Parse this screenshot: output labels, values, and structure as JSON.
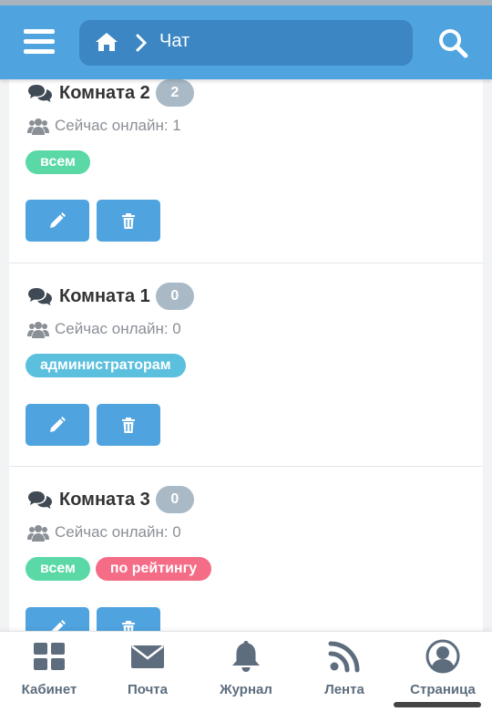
{
  "header": {
    "breadcrumb_label": "Чат",
    "home_icon": "home-icon",
    "chevron_icon": "chevron-right-icon",
    "menu_icon": "hamburger-menu-icon",
    "search_icon": "search-icon",
    "bg_color": "#4fa3df"
  },
  "rooms": [
    {
      "name": "Комната 2",
      "count": "2",
      "online_text": "Сейчас онлайн: 1",
      "tags": [
        {
          "label": "всем",
          "color": "#5ad9a6"
        }
      ],
      "edit_icon": "pencil-icon",
      "delete_icon": "trash-icon"
    },
    {
      "name": "Комната 1",
      "count": "0",
      "online_text": "Сейчас онлайн: 0",
      "tags": [
        {
          "label": "администраторам",
          "color": "#5bc0de"
        }
      ],
      "edit_icon": "pencil-icon",
      "delete_icon": "trash-icon"
    },
    {
      "name": "Комната 3",
      "count": "0",
      "online_text": "Сейчас онлайн: 0",
      "tags": [
        {
          "label": "всем",
          "color": "#5ad9a6"
        },
        {
          "label": "по рейтингу",
          "color": "#f56c86"
        }
      ],
      "edit_icon": "pencil-icon",
      "delete_icon": "trash-icon"
    }
  ],
  "bottom_nav": {
    "items": [
      {
        "label": "Кабинет",
        "icon": "dashboard-icon"
      },
      {
        "label": "Почта",
        "icon": "envelope-icon"
      },
      {
        "label": "Журнал",
        "icon": "bell-icon"
      },
      {
        "label": "Лента",
        "icon": "rss-icon"
      },
      {
        "label": "Страница",
        "icon": "user-circle-icon"
      }
    ]
  }
}
